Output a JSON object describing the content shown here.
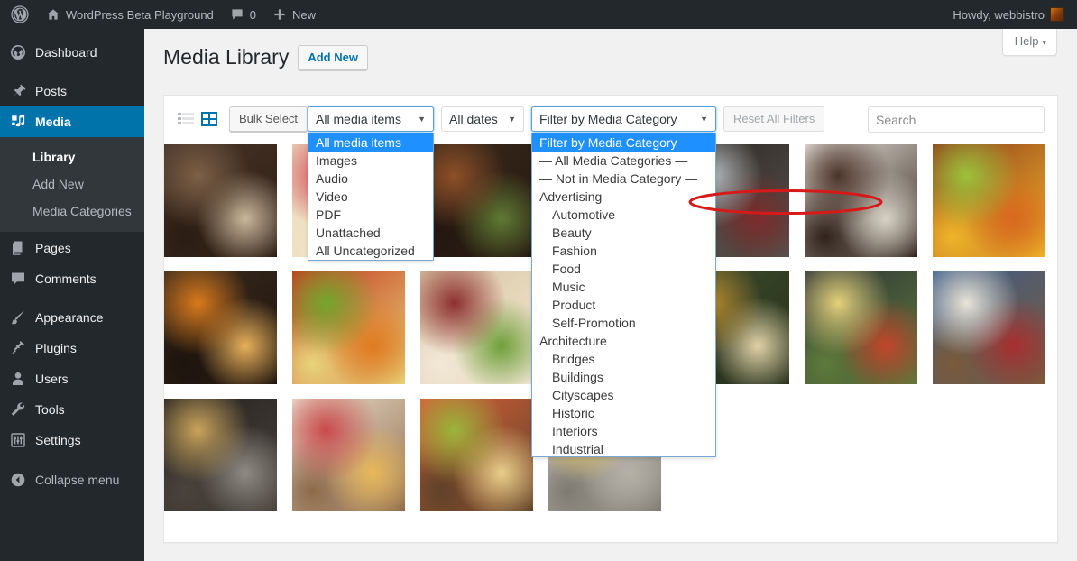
{
  "adminbar": {
    "logo_icon": "wordpress-logo-icon",
    "site_icon": "home-icon",
    "site_name": "WordPress Beta Playground",
    "comments_icon": "comment-bubble-icon",
    "comments_count": "0",
    "new_icon": "plus-icon",
    "new_label": "New",
    "howdy": "Howdy, webbistro",
    "avatar": "user-avatar"
  },
  "sidebar": {
    "items": [
      {
        "label": "Dashboard",
        "icon": "dashboard-icon",
        "current": false
      },
      {
        "label": "Posts",
        "icon": "pin-icon",
        "current": false
      },
      {
        "label": "Media",
        "icon": "media-icon",
        "current": true
      },
      {
        "label": "Pages",
        "icon": "pages-icon",
        "current": false
      },
      {
        "label": "Comments",
        "icon": "comments-icon",
        "current": false
      },
      {
        "label": "Appearance",
        "icon": "brush-icon",
        "current": false
      },
      {
        "label": "Plugins",
        "icon": "plug-icon",
        "current": false
      },
      {
        "label": "Users",
        "icon": "user-icon",
        "current": false
      },
      {
        "label": "Tools",
        "icon": "wrench-icon",
        "current": false
      },
      {
        "label": "Settings",
        "icon": "sliders-icon",
        "current": false
      }
    ],
    "submenu": [
      {
        "label": "Library",
        "current": true
      },
      {
        "label": "Add New",
        "current": false
      },
      {
        "label": "Media Categories",
        "current": false
      }
    ],
    "collapse": {
      "label": "Collapse menu",
      "icon": "collapse-arrow-icon"
    }
  },
  "screen": {
    "help_label": "Help",
    "help_caret": "▾",
    "page_title": "Media Library",
    "add_new_label": "Add New"
  },
  "toolbar": {
    "view_list_icon": "list-view-icon",
    "view_grid_icon": "grid-view-icon",
    "bulk_select_label": "Bulk Select",
    "reset_label": "Reset All Filters",
    "search_placeholder": "Search",
    "search_value": "",
    "media_type": {
      "name": "media-type-filter",
      "value": "All media items",
      "open": true,
      "options": [
        {
          "label": "All media items",
          "selected": true
        },
        {
          "label": "Images",
          "selected": false
        },
        {
          "label": "Audio",
          "selected": false
        },
        {
          "label": "Video",
          "selected": false
        },
        {
          "label": "PDF",
          "selected": false
        },
        {
          "label": "Unattached",
          "selected": false
        },
        {
          "label": "All Uncategorized",
          "selected": false
        }
      ]
    },
    "dates": {
      "name": "date-filter",
      "value": "All dates",
      "open": false,
      "options": [
        {
          "label": "All dates",
          "selected": true
        }
      ]
    },
    "media_category": {
      "name": "media-category-filter",
      "value": "Filter by Media Category",
      "open": true,
      "options": [
        {
          "label": "Filter by Media Category",
          "selected": true,
          "level": 0
        },
        {
          "label": "— All Media Categories —",
          "selected": false,
          "level": 0
        },
        {
          "label": "— Not in Media Category —",
          "selected": false,
          "level": 0,
          "annotated": true
        },
        {
          "label": "Advertising",
          "selected": false,
          "level": 0
        },
        {
          "label": "Automotive",
          "selected": false,
          "level": 1
        },
        {
          "label": "Beauty",
          "selected": false,
          "level": 1
        },
        {
          "label": "Fashion",
          "selected": false,
          "level": 1
        },
        {
          "label": "Food",
          "selected": false,
          "level": 1
        },
        {
          "label": "Music",
          "selected": false,
          "level": 1
        },
        {
          "label": "Product",
          "selected": false,
          "level": 1
        },
        {
          "label": "Self-Promotion",
          "selected": false,
          "level": 1
        },
        {
          "label": "Architecture",
          "selected": false,
          "level": 0
        },
        {
          "label": "Bridges",
          "selected": false,
          "level": 1
        },
        {
          "label": "Buildings",
          "selected": false,
          "level": 1
        },
        {
          "label": "Cityscapes",
          "selected": false,
          "level": 1
        },
        {
          "label": "Historic",
          "selected": false,
          "level": 1
        },
        {
          "label": "Interiors",
          "selected": false,
          "level": 1
        },
        {
          "label": "Industrial",
          "selected": false,
          "level": 1
        }
      ]
    }
  },
  "annotation": {
    "shape": "ellipse",
    "color": "#d61a1a",
    "target": "— Not in Media Category —"
  },
  "grid": {
    "columns": 7,
    "rows": 3,
    "items": [
      {
        "row": 0,
        "col": 0,
        "subject": "rolling-pin-dough-on-dark-board"
      },
      {
        "row": 0,
        "col": 1,
        "subject": "berry-tart-with-blueberries"
      },
      {
        "row": 0,
        "col": 2,
        "subject": "grilled-meat-skewers-with-rosemary"
      },
      {
        "row": 0,
        "col": 3,
        "subject": "bread-loaf-on-cutting-board"
      },
      {
        "row": 0,
        "col": 4,
        "subject": "silver-cutlery-on-dark-cloth"
      },
      {
        "row": 0,
        "col": 5,
        "subject": "coffee-cup-with-coffee-beans"
      },
      {
        "row": 0,
        "col": 6,
        "subject": "chocolate-muffins-in-colored-cases"
      },
      {
        "row": 1,
        "col": 0,
        "subject": "preserving-jar-with-orange-peel"
      },
      {
        "row": 1,
        "col": 1,
        "subject": "tomatoes-carrots-and-vegetables"
      },
      {
        "row": 1,
        "col": 2,
        "subject": "sandwich-with-lettuce-and-tomato"
      },
      {
        "row": 1,
        "col": 3,
        "subject": "red-pepper-and-spices"
      },
      {
        "row": 1,
        "col": 4,
        "subject": "hand-stirring-vegetable-stir-fry"
      },
      {
        "row": 1,
        "col": 5,
        "subject": "pasta-and-vegetables-in-black-pan"
      },
      {
        "row": 1,
        "col": 6,
        "subject": "berries-and-granola-on-blue-checked-cloth"
      },
      {
        "row": 2,
        "col": 0,
        "subject": "fish-fillet-frying-in-pan"
      },
      {
        "row": 2,
        "col": 1,
        "subject": "champagne-glasses-and-dessert"
      },
      {
        "row": 2,
        "col": 2,
        "subject": "salmon-fillet-with-lemon-on-board"
      },
      {
        "row": 2,
        "col": 3,
        "subject": "spaghetti-in-pot-of-water"
      }
    ]
  },
  "colors": {
    "admin_bar": "#23282d",
    "sidebar": "#23282d",
    "submenu": "#32373c",
    "current_menu": "#0073aa",
    "link": "#0073aa",
    "dropdown_highlight": "#1e90ff",
    "annotation": "#d61a1a",
    "content_bg": "#f1f1f1"
  }
}
